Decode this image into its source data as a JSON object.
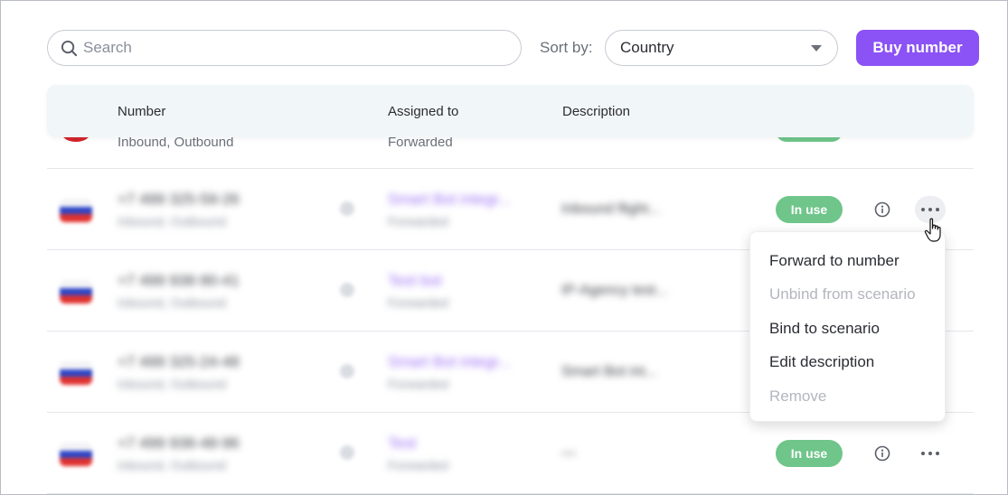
{
  "toolbar": {
    "search_placeholder": "Search",
    "sort_label": "Sort by:",
    "sort_value": "Country",
    "buy_label": "Buy number"
  },
  "table": {
    "columns": [
      "Number",
      "Assigned to",
      "Description"
    ],
    "partial_row": {
      "number_sub": "Inbound, Outbound",
      "assigned_sub": "Forwarded"
    },
    "rows": [
      {
        "number": "+7 499 325-59-26",
        "number_sub": "Inbound, Outbound",
        "assigned": "Smart Bot integr...",
        "assigned_sub": "Forwarded",
        "description": "Inbound flight...",
        "status": "In use",
        "menu_open": true
      },
      {
        "number": "+7 499 938-90-41",
        "number_sub": "Inbound, Outbound",
        "assigned": "Test bot",
        "assigned_sub": "Forwarded",
        "description": "IP-Agency test...",
        "status": "",
        "menu_open": false
      },
      {
        "number": "+7 499 325-24-48",
        "number_sub": "Inbound, Outbound",
        "assigned": "Smart Bot integr...",
        "assigned_sub": "Forwarded",
        "description": "Smart Bot int...",
        "status": "",
        "menu_open": false
      },
      {
        "number": "+7 499 938-48-96",
        "number_sub": "Inbound, Outbound",
        "assigned": "Test",
        "assigned_sub": "Forwarded",
        "description": "—",
        "status": "In use",
        "menu_open": false
      }
    ]
  },
  "menu": {
    "items": [
      {
        "label": "Forward to number",
        "disabled": false
      },
      {
        "label": "Unbind from scenario",
        "disabled": true
      },
      {
        "label": "Bind to scenario",
        "disabled": false
      },
      {
        "label": "Edit description",
        "disabled": false
      },
      {
        "label": "Remove",
        "disabled": true
      }
    ]
  },
  "colors": {
    "accent": "#8b52f5",
    "status_green": "#6fc58a",
    "header_bg": "#f1f6f9"
  }
}
